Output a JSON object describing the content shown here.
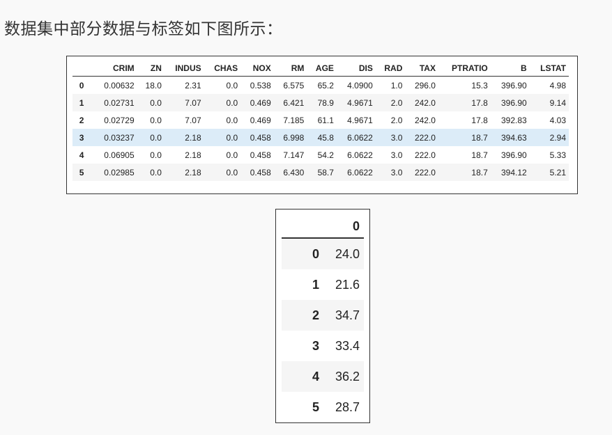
{
  "heading": "数据集中部分数据与标签如下图所示：",
  "features_table": {
    "columns": [
      "",
      "CRIM",
      "ZN",
      "INDUS",
      "CHAS",
      "NOX",
      "RM",
      "AGE",
      "DIS",
      "RAD",
      "TAX",
      "PTRATIO",
      "B",
      "LSTAT"
    ],
    "rows": [
      [
        "0",
        "0.00632",
        "18.0",
        "2.31",
        "0.0",
        "0.538",
        "6.575",
        "65.2",
        "4.0900",
        "1.0",
        "296.0",
        "15.3",
        "396.90",
        "4.98"
      ],
      [
        "1",
        "0.02731",
        "0.0",
        "7.07",
        "0.0",
        "0.469",
        "6.421",
        "78.9",
        "4.9671",
        "2.0",
        "242.0",
        "17.8",
        "396.90",
        "9.14"
      ],
      [
        "2",
        "0.02729",
        "0.0",
        "7.07",
        "0.0",
        "0.469",
        "7.185",
        "61.1",
        "4.9671",
        "2.0",
        "242.0",
        "17.8",
        "392.83",
        "4.03"
      ],
      [
        "3",
        "0.03237",
        "0.0",
        "2.18",
        "0.0",
        "0.458",
        "6.998",
        "45.8",
        "6.0622",
        "3.0",
        "222.0",
        "18.7",
        "394.63",
        "2.94"
      ],
      [
        "4",
        "0.06905",
        "0.0",
        "2.18",
        "0.0",
        "0.458",
        "7.147",
        "54.2",
        "6.0622",
        "3.0",
        "222.0",
        "18.7",
        "396.90",
        "5.33"
      ],
      [
        "5",
        "0.02985",
        "0.0",
        "2.18",
        "0.0",
        "0.458",
        "6.430",
        "58.7",
        "6.0622",
        "3.0",
        "222.0",
        "18.7",
        "394.12",
        "5.21"
      ]
    ],
    "highlight_color": "#dcecf8"
  },
  "labels_table": {
    "columns": [
      "",
      "0"
    ],
    "rows": [
      [
        "0",
        "24.0"
      ],
      [
        "1",
        "21.6"
      ],
      [
        "2",
        "34.7"
      ],
      [
        "3",
        "33.4"
      ],
      [
        "4",
        "36.2"
      ],
      [
        "5",
        "28.7"
      ]
    ]
  }
}
